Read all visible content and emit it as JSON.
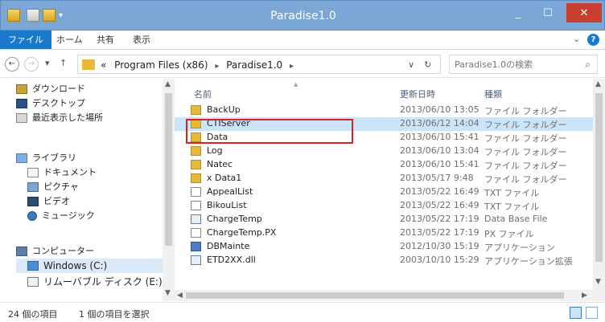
{
  "window": {
    "title": "Paradise1.0",
    "minimize": "_",
    "maximize": "☐",
    "close": "✕"
  },
  "ribbon": {
    "tabs": [
      "ファイル",
      "ホーム",
      "共有",
      "表示"
    ],
    "expand": "⌄",
    "help": "?"
  },
  "address": {
    "back": "←",
    "forward": "→",
    "recent": "▾",
    "up": "↑",
    "overflow": "«",
    "crumbs": [
      "Program Files (x86)",
      "Paradise1.0"
    ],
    "crumb_sep": "▸",
    "dropdown": "∨",
    "refresh": "↻",
    "search_placeholder": "Paradise1.0の検索",
    "search_icon": "⌕"
  },
  "nav": {
    "items": [
      {
        "label": "ダウンロード",
        "icon": "download-icon"
      },
      {
        "label": "デスクトップ",
        "icon": "desktop-icon"
      },
      {
        "label": "最近表示した場所",
        "icon": "recent-places-icon"
      },
      {
        "label": "ライブラリ",
        "icon": "library-icon"
      },
      {
        "label": "ドキュメント",
        "icon": "documents-icon"
      },
      {
        "label": "ピクチャ",
        "icon": "pictures-icon"
      },
      {
        "label": "ビデオ",
        "icon": "videos-icon"
      },
      {
        "label": "ミュージック",
        "icon": "music-icon"
      },
      {
        "label": "コンピューター",
        "icon": "computer-icon"
      },
      {
        "label": "Windows (C:)",
        "icon": "windows-drive-icon"
      },
      {
        "label": "リムーバブル ディスク (E:)",
        "icon": "removable-disk-icon"
      }
    ]
  },
  "list": {
    "headers": {
      "name": "名前",
      "date": "更新日時",
      "type": "種類"
    },
    "rows": [
      {
        "name": "BackUp",
        "date": "2013/06/10 13:05",
        "type": "ファイル フォルダー",
        "icon": "folder"
      },
      {
        "name": "CTIServer",
        "date": "2013/06/12 14:04",
        "type": "ファイル フォルダー",
        "icon": "folder"
      },
      {
        "name": "Data",
        "date": "2013/06/10 15:41",
        "type": "ファイル フォルダー",
        "icon": "folder"
      },
      {
        "name": "Log",
        "date": "2013/06/10 13:04",
        "type": "ファイル フォルダー",
        "icon": "folder"
      },
      {
        "name": "Natec",
        "date": "2013/06/10 15:41",
        "type": "ファイル フォルダー",
        "icon": "folder"
      },
      {
        "name": "x Data1",
        "date": "2013/05/17 9:48",
        "type": "ファイル フォルダー",
        "icon": "folder"
      },
      {
        "name": "AppealList",
        "date": "2013/05/22 16:49",
        "type": "TXT ファイル",
        "icon": "txt"
      },
      {
        "name": "BikouList",
        "date": "2013/05/22 16:49",
        "type": "TXT ファイル",
        "icon": "txt"
      },
      {
        "name": "ChargeTemp",
        "date": "2013/05/22 17:19",
        "type": "Data Base File",
        "icon": "db"
      },
      {
        "name": "ChargeTemp.PX",
        "date": "2013/05/22 17:19",
        "type": "PX ファイル",
        "icon": "txt"
      },
      {
        "name": "DBMainte",
        "date": "2012/10/30 15:19",
        "type": "アプリケーション",
        "icon": "app"
      },
      {
        "name": "ETD2XX.dll",
        "date": "2003/10/10 15:29",
        "type": "アプリケーション拡張",
        "icon": "db"
      }
    ],
    "selected_name": "CTIServer"
  },
  "status": {
    "count": "24 個の項目",
    "selection": "1 個の項目を選択"
  }
}
